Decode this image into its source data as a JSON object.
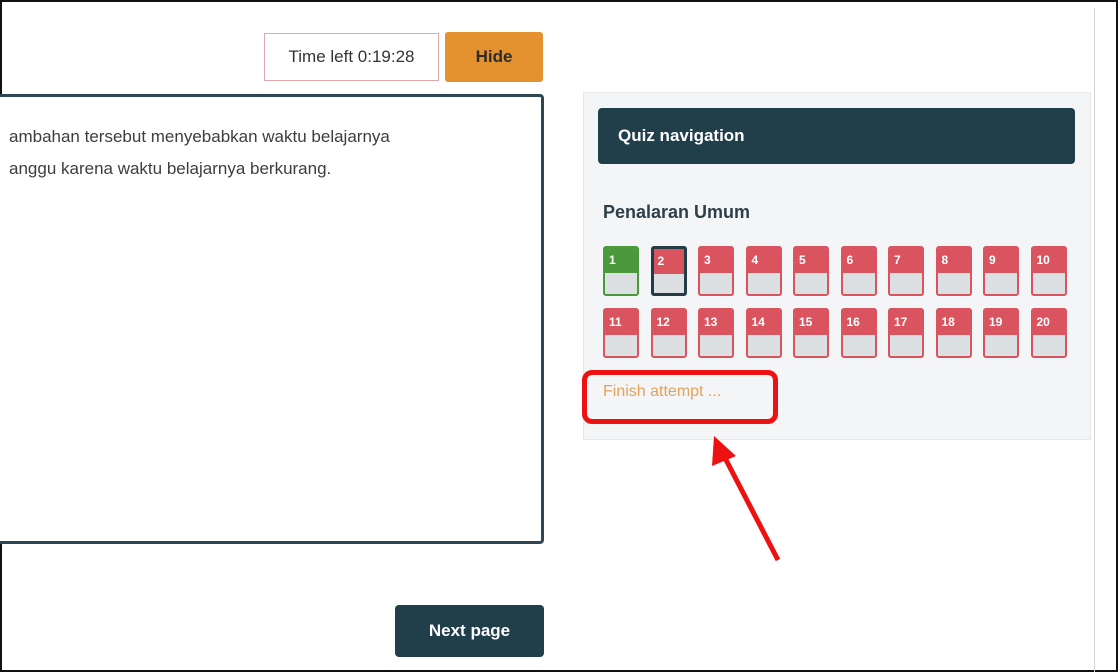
{
  "timer": {
    "text": "Time left 0:19:28"
  },
  "hide_button": {
    "label": "Hide"
  },
  "question": {
    "lines": [
      "ambahan tersebut menyebabkan waktu belajarnya",
      "anggu karena waktu belajarnya berkurang."
    ]
  },
  "quiz_nav": {
    "title": "Quiz navigation",
    "section": "Penalaran Umum",
    "questions": [
      {
        "num": "1",
        "state": "answered"
      },
      {
        "num": "2",
        "state": "current"
      },
      {
        "num": "3",
        "state": "flagged"
      },
      {
        "num": "4",
        "state": "flagged"
      },
      {
        "num": "5",
        "state": "flagged"
      },
      {
        "num": "6",
        "state": "flagged"
      },
      {
        "num": "7",
        "state": "flagged"
      },
      {
        "num": "8",
        "state": "flagged"
      },
      {
        "num": "9",
        "state": "flagged"
      },
      {
        "num": "10",
        "state": "flagged"
      },
      {
        "num": "11",
        "state": "flagged"
      },
      {
        "num": "12",
        "state": "flagged"
      },
      {
        "num": "13",
        "state": "flagged"
      },
      {
        "num": "14",
        "state": "flagged"
      },
      {
        "num": "15",
        "state": "flagged"
      },
      {
        "num": "16",
        "state": "flagged"
      },
      {
        "num": "17",
        "state": "flagged"
      },
      {
        "num": "18",
        "state": "flagged"
      },
      {
        "num": "19",
        "state": "flagged"
      },
      {
        "num": "20",
        "state": "flagged"
      }
    ],
    "finish_link": "Finish attempt ..."
  },
  "next_button": {
    "label": "Next page"
  },
  "colors": {
    "accent_orange": "#e4922f",
    "nav_dark": "#213e4b",
    "flag_red": "#d9545f",
    "answered_green": "#4a9a3c",
    "annotation_red": "#ee1111"
  },
  "annotation": {
    "shape": "red rounded rectangle with arrow pointing at finish link"
  }
}
